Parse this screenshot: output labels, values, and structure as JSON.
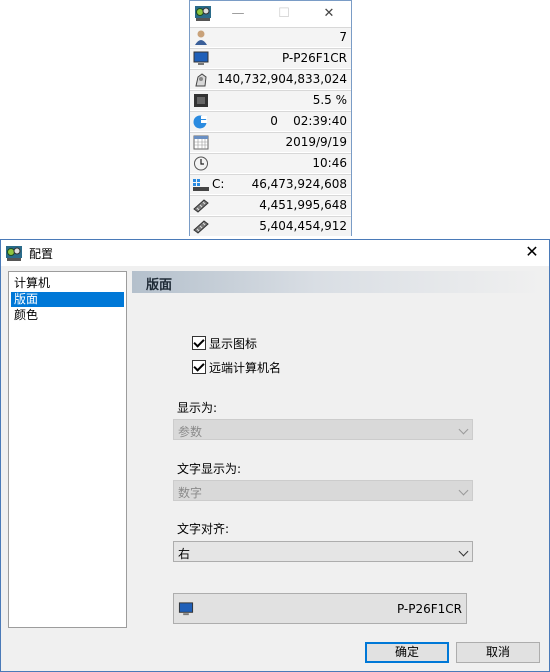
{
  "mini_window": {
    "app_icon": "app-gears-icon",
    "minimize": "—",
    "maximize": "☐",
    "close": "✕",
    "rows": [
      {
        "icon": "user-icon",
        "value": "7"
      },
      {
        "icon": "computer-icon",
        "value": "P-P26F1CR"
      },
      {
        "icon": "cpu-cycles-icon",
        "value": "140,732,904,833,024"
      },
      {
        "icon": "processor-chip-icon",
        "value": "5.5 %"
      },
      {
        "icon": "uptime-icon",
        "value": "0    02:39:40"
      },
      {
        "icon": "calendar-icon",
        "value": "2019/9/19"
      },
      {
        "icon": "clock-icon",
        "value": "10:46"
      },
      {
        "icon": "drive-icon",
        "drive": "C:",
        "value": "46,473,924,608"
      },
      {
        "icon": "memory-icon",
        "value": "4,451,995,648"
      },
      {
        "icon": "memory-icon",
        "value": "5,404,454,912"
      }
    ]
  },
  "dialog": {
    "title": "配置",
    "close": "✕",
    "tree": [
      "计算机",
      "版面",
      "颜色"
    ],
    "selected_index": 1,
    "section_title": "版面",
    "show_icon_label": "显示图标",
    "remote_name_label": "远端计算机名",
    "display_as_label": "显示为:",
    "display_as_value": "参数",
    "text_display_label": "文字显示为:",
    "text_display_value": "数字",
    "text_align_label": "文字对齐:",
    "text_align_value": "右",
    "preview_value": "P-P26F1CR",
    "ok_label": "确定",
    "cancel_label": "取消"
  },
  "colors": {
    "selection": "#0078d7",
    "border": "#4a7ab8"
  }
}
